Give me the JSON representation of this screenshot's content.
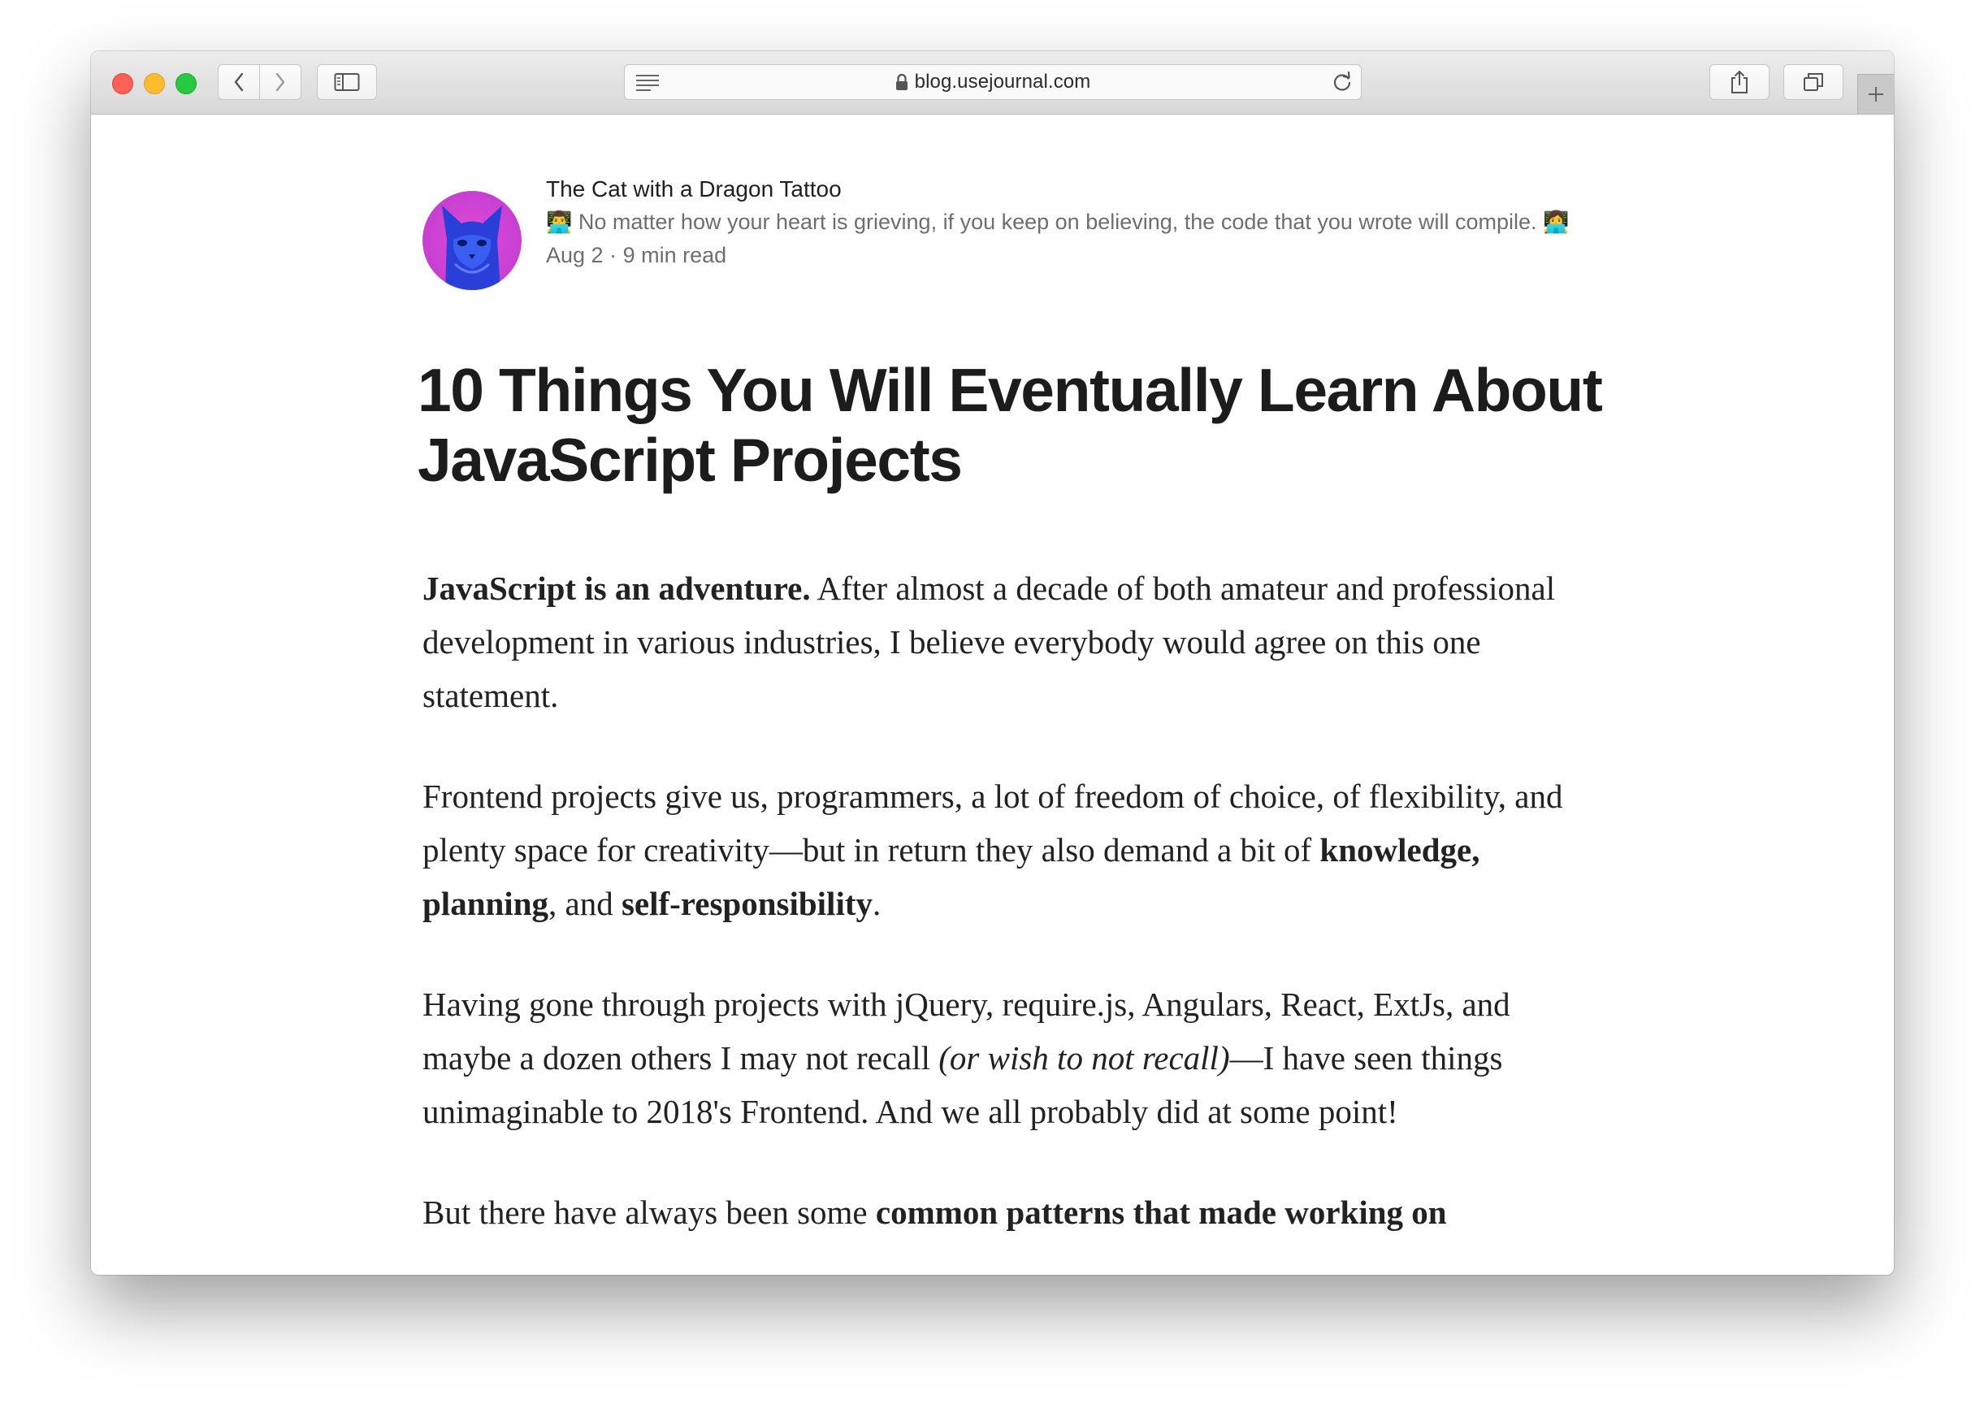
{
  "browser": {
    "url": "blog.usejournal.com",
    "icons": {
      "back": "chevron-left-icon",
      "forward": "chevron-right-icon",
      "sidebar": "sidebar-icon",
      "reader": "reader-icon",
      "lock": "lock-icon",
      "reload": "reload-icon",
      "share": "share-icon",
      "tabs": "tabs-icon",
      "new_tab": "plus-icon"
    }
  },
  "author": {
    "name": "The Cat with a Dragon Tattoo",
    "bio_emoji_start": "👨‍💻",
    "bio": "No matter how your heart is grieving, if you keep on believing, the code that you wrote will compile.",
    "bio_emoji_end": "👩‍💻",
    "date": "Aug 2",
    "separator": "·",
    "read_time": "9 min read"
  },
  "article": {
    "title": "10 Things You Will Eventually Learn About JavaScript Projects",
    "p1_bold": "JavaScript is an adventure.",
    "p1_rest": " After almost a decade of both amateur and professional development in various industries, I believe everybody would agree on this one statement.",
    "p2_start": "Frontend projects give us, programmers, a lot of freedom of choice, of flexibility, and plenty space for creativity—but in return they also demand a bit of ",
    "p2_b1": "knowledge",
    "p2_c1": ", ",
    "p2_b2": "planning",
    "p2_c2": ", and ",
    "p2_b3": "self-responsibility",
    "p2_end": ".",
    "p3_start": "Having gone through projects with jQuery, require.js, Angulars, React, ExtJs, and maybe a dozen others I may not recall ",
    "p3_italic": "(or wish to not recall)",
    "p3_end": "—I have seen things unimaginable to 2018's Frontend. And we all probably did at some point!",
    "p4_start": "But there have always been some ",
    "p4_bold": "common patterns that made working on"
  }
}
